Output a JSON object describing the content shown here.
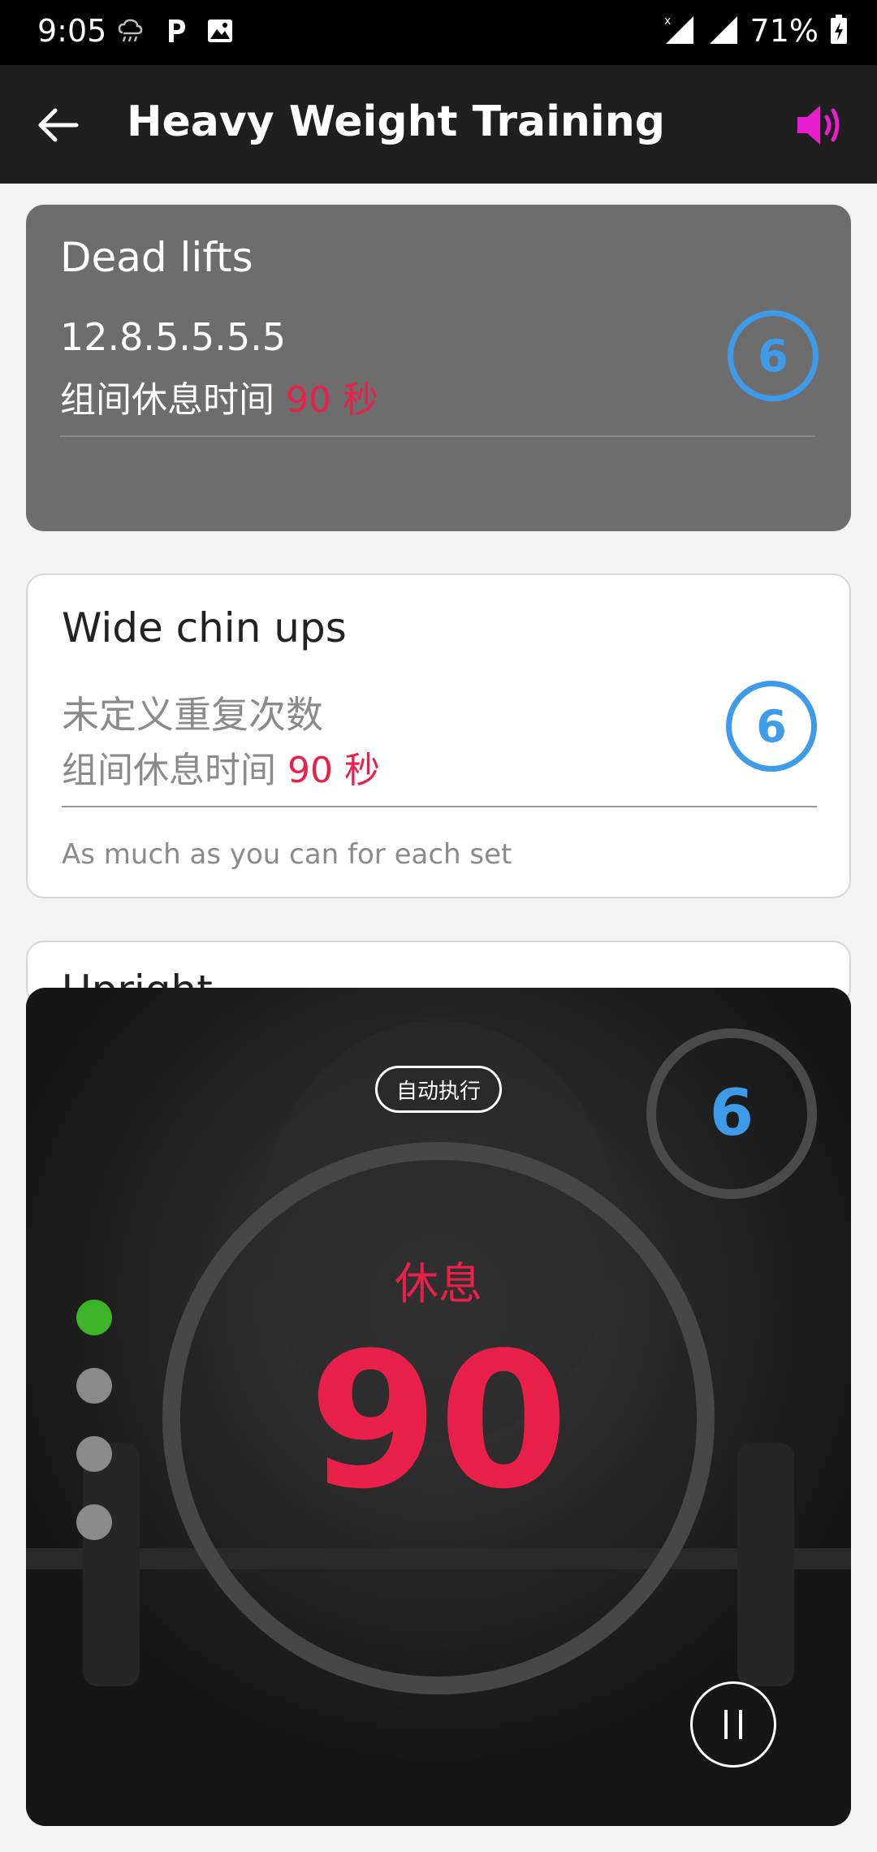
{
  "status_bar": {
    "time": "9:05",
    "battery": "71%",
    "icons": [
      "cloud-rain-icon",
      "parking-icon",
      "image-icon",
      "signal-no-data-icon",
      "signal-icon",
      "battery-charging-icon"
    ]
  },
  "app_bar": {
    "title": "Heavy Weight Training",
    "back_icon": "arrow-left-icon",
    "sound_icon": "speaker-icon",
    "accent_color": "#e91ecf"
  },
  "exercises": [
    {
      "title": "Dead lifts",
      "reps": "12.8.5.5.5.5",
      "rest_prefix": "组间休息时间",
      "rest_value": "90 秒",
      "sets": "6",
      "note": "",
      "active": true
    },
    {
      "title": "Wide chin ups",
      "reps": "未定义重复次数",
      "rest_prefix": "组间休息时间",
      "rest_value": "90 秒",
      "sets": "6",
      "note": "As much as you can for each set",
      "active": false
    },
    {
      "title": "Upright",
      "reps": "",
      "rest_prefix": "",
      "rest_value": "",
      "sets": "",
      "note": "",
      "active": false
    }
  ],
  "rest_overlay": {
    "auto_label": "自动执行",
    "set_count": "6",
    "status_label": "休息",
    "timer": "90",
    "progress": {
      "current": 1,
      "total": 4
    },
    "pause_icon": "pause-icon"
  },
  "colors": {
    "accent_red": "#e8204a",
    "accent_blue": "#3d9be9",
    "active_dot": "#3fb42a",
    "inactive_dot": "#8b8b8b"
  }
}
